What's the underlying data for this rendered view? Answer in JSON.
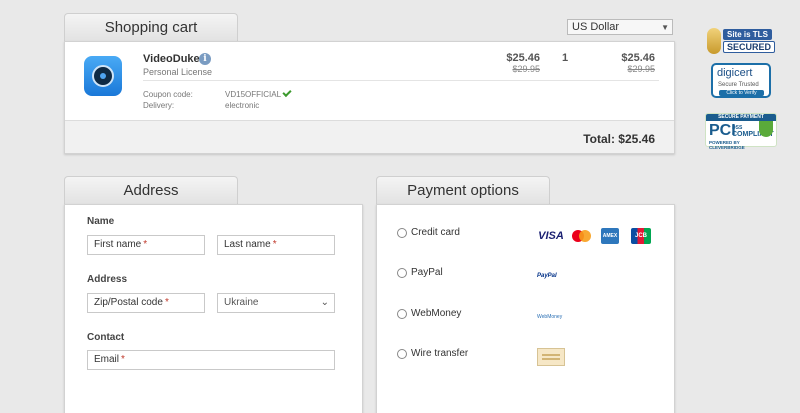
{
  "cart": {
    "tab_label": "Shopping cart",
    "currency": "US Dollar",
    "product": {
      "name": "VideoDuke",
      "license": "Personal License",
      "unit_price": "$25.46",
      "unit_price_old": "$29.95",
      "quantity": "1",
      "total_price": "$25.46",
      "total_price_old": "$29.95",
      "coupon_label": "Coupon code:",
      "coupon_value": "VD15OFFICIAL",
      "delivery_label": "Delivery:",
      "delivery_value": "electronic"
    },
    "total_text": "Total:  $25.46"
  },
  "badges": {
    "tls_line1": "Site is TLS",
    "tls_line2": "SECURED",
    "digicert_brand": "digicert",
    "digicert_sub": "Secure  Trusted",
    "digicert_verify": "Click to Verify",
    "pci_top": "SECURE PAYMENT",
    "pci_big": "PCI",
    "pci_dss": "DSS",
    "pci_compliant": "COMPLIANT",
    "pci_by": "POWERED BY CLEVERBRIDGE"
  },
  "address": {
    "tab_label": "Address",
    "name_label": "Name",
    "first_name_placeholder": "First name",
    "last_name_placeholder": "Last name",
    "address_label": "Address",
    "zip_placeholder": "Zip/Postal code",
    "country": "Ukraine",
    "contact_label": "Contact",
    "email_placeholder": "Email",
    "required_mark": "*"
  },
  "payment": {
    "tab_label": "Payment options",
    "options": [
      {
        "label": "Credit card"
      },
      {
        "label": "PayPal"
      },
      {
        "label": "WebMoney"
      },
      {
        "label": "Wire transfer"
      }
    ],
    "visa": "VISA",
    "amex": "AMEX",
    "jcb": "JCB",
    "paypal_logo": "PayPal",
    "webmoney_logo": "WebMoney"
  },
  "colors": {
    "background": "#e9e9e9",
    "required": "#c0392b",
    "check": "#3c9a2e"
  }
}
